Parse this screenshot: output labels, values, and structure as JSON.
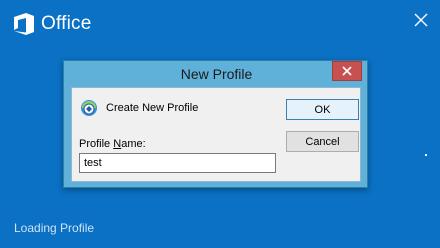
{
  "app": {
    "logo_text": "Office",
    "status_text": "Loading Profile"
  },
  "dialog": {
    "title": "New Profile",
    "create_label": "Create New Profile",
    "name_label_prefix": "Profile ",
    "name_label_underlined": "N",
    "name_label_suffix": "ame:",
    "name_value": "test",
    "ok_label": "OK",
    "cancel_label": "Cancel"
  },
  "colors": {
    "background": "#0a71c5",
    "dialog_frame": "#5fb1d9",
    "close_button": "#c75050"
  },
  "icons": [
    "office-logo-icon",
    "close-icon",
    "profile-icon"
  ]
}
